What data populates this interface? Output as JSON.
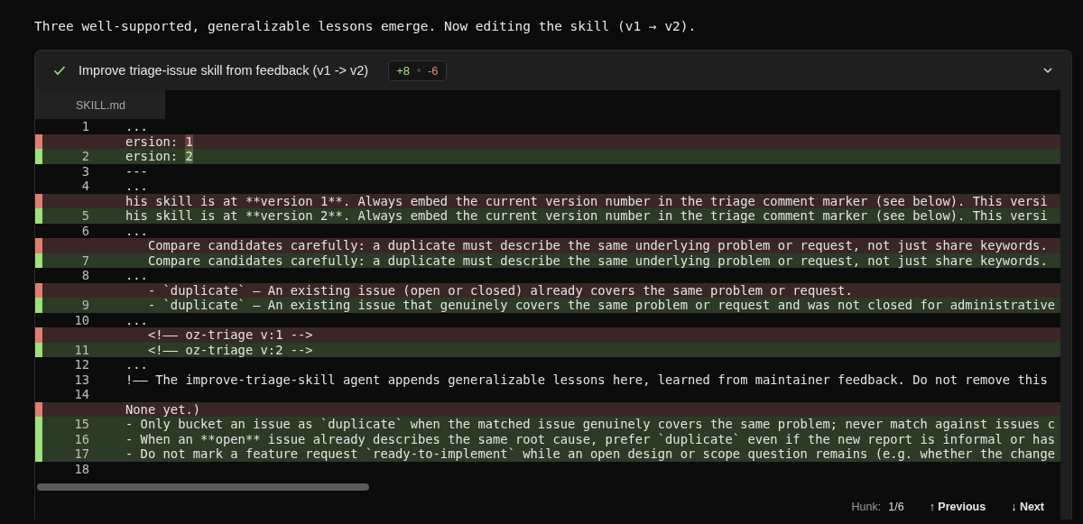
{
  "message": "Three well-supported, generalizable lessons emerge. Now editing the skill (v1 → v2).",
  "card": {
    "done": true,
    "title": "Improve triage-issue skill from feedback (v1 -> v2)",
    "added": "+8",
    "removed": "-6",
    "expanded": true
  },
  "file_tab": {
    "label": "SKILL.md",
    "selected": true
  },
  "lines": [
    {
      "kind": "context",
      "number": "1",
      "text": "..."
    },
    {
      "kind": "removed",
      "text": "ersion: ",
      "changed": "1"
    },
    {
      "kind": "added",
      "number": "2",
      "text": "ersion: ",
      "changed": "2"
    },
    {
      "kind": "context",
      "number": "3",
      "text": "---"
    },
    {
      "kind": "context",
      "number": "4",
      "text": "..."
    },
    {
      "kind": "removed",
      "text": "his skill is at **version 1**. Always embed the current version number in the triage comment marker (see below). This versi"
    },
    {
      "kind": "added",
      "number": "5",
      "text": "his skill is at **version 2**. Always embed the current version number in the triage comment marker (see below). This versi"
    },
    {
      "kind": "context",
      "number": "6",
      "text": "..."
    },
    {
      "kind": "removed",
      "text": "   Compare candidates carefully: a duplicate must describe the same underlying problem or request, not just share keywords."
    },
    {
      "kind": "added",
      "number": "7",
      "text": "   Compare candidates carefully: a duplicate must describe the same underlying problem or request, not just share keywords."
    },
    {
      "kind": "context",
      "number": "8",
      "text": "..."
    },
    {
      "kind": "removed",
      "text": "   - `duplicate` — An existing issue (open or closed) already covers the same problem or request."
    },
    {
      "kind": "added",
      "number": "9",
      "text": "   - `duplicate` — An existing issue that genuinely covers the same problem or request and was not closed for administrative"
    },
    {
      "kind": "context",
      "number": "10",
      "text": "..."
    },
    {
      "kind": "removed",
      "text": "   <!—— oz-triage v:1 -->"
    },
    {
      "kind": "added",
      "number": "11",
      "text": "   <!—— oz-triage v:2 -->"
    },
    {
      "kind": "context",
      "number": "12",
      "text": "..."
    },
    {
      "kind": "context",
      "number": "13",
      "text": "!—— The improve-triage-skill agent appends generalizable lessons here, learned from maintainer feedback. Do not remove this"
    },
    {
      "kind": "context",
      "number": "14"
    },
    {
      "kind": "removed",
      "text": "None yet.)"
    },
    {
      "kind": "added",
      "number": "15",
      "text": "- Only bucket an issue as `duplicate` when the matched issue genuinely covers the same problem; never match against issues c"
    },
    {
      "kind": "added",
      "number": "16",
      "text": "- When an **open** issue already describes the same root cause, prefer `duplicate` even if the new report is informal or has"
    },
    {
      "kind": "added",
      "number": "17",
      "text": "- Do not mark a feature request `ready-to-implement` while an open design or scope question remains (e.g. whether the change"
    },
    {
      "kind": "context",
      "number": "18"
    }
  ],
  "footer": {
    "hunk_label": "Hunk:",
    "hunk_value": "1/6",
    "previous": "↑ Previous",
    "next": "↓ Next"
  }
}
